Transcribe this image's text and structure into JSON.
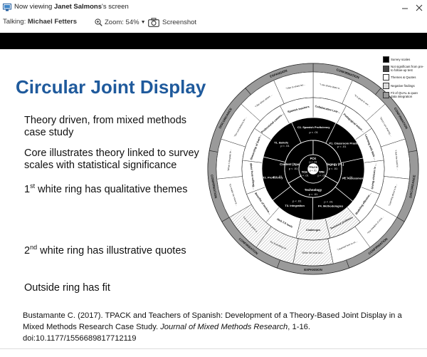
{
  "window": {
    "title_prefix": "Now viewing ",
    "presenter": "Janet Salmons",
    "title_suffix": "'s screen"
  },
  "toolbar": {
    "talking_label": "Talking: ",
    "talking_name": "Michael Fetters",
    "zoom_label": "Zoom: 54%",
    "screenshot_label": "Screenshot"
  },
  "slide": {
    "title": "Circular Joint Display",
    "bullets": [
      {
        "lines": [
          "Theory driven, from mixed methods",
          "case study"
        ]
      },
      {
        "lines": [
          "Core illustrates theory linked to survey",
          "scales with statistical significance"
        ]
      },
      {
        "pre": "1",
        "sup": "st",
        "post": " white ring has qualitative themes"
      },
      {
        "pre": "2",
        "sup": "nd",
        "post": " white ring has illustrative quotes"
      },
      {
        "lines": [
          "Outside ring has fit"
        ]
      }
    ],
    "citation": {
      "main": "Bustamante C. (2017). TPACK and Teachers of Spanish: Development of a Theory-Based Joint Display in a Mixed Methods Research Case Study. ",
      "journal": "Journal of Mixed Methods Research",
      "tail": ", 1-16. doi:10.1177/1556689817712119"
    }
  },
  "diagram": {
    "center": {
      "label": "TPACK",
      "value": "p < .01"
    },
    "core_sectors": [
      {
        "label": "PCK",
        "value": "p < .01"
      },
      {
        "label": "TPK",
        "value": "p < .01"
      },
      {
        "label": "TCK",
        "value": "p < .01"
      }
    ],
    "domains": [
      {
        "label": "Content (Spanish)",
        "value": "p < .01"
      },
      {
        "label": "Pedagogy (FL)",
        "value": "p < .01"
      },
      {
        "label": "Technology",
        "value": "p < .01"
      }
    ],
    "survey_scales": [
      {
        "label": "C1. Spanish Proficiency",
        "value": "p < .01"
      },
      {
        "label": "P1. Classroom Practices",
        "value": "p < .01"
      },
      {
        "label": "P2. Assessment",
        "value": "p < .01"
      },
      {
        "label": "P4. Methodologies",
        "value": "p < .01"
      },
      {
        "label": "T3. Integration",
        "value": "p < .01"
      },
      {
        "label": "T2. Proficiency",
        "value": "p < .01"
      },
      {
        "label": "T1. Beliefs",
        "value": "p < .01"
      }
    ],
    "themes": [
      "Collaborative Learning",
      "Pedagogical Intentionality",
      "Learning with Web 2.0",
      "Giving choices to students",
      "Modeling effective approaches",
      "Technical problems",
      "Challenges",
      "Web 2.0 tools",
      "Benefits of technology",
      "Ideas from colleagues",
      "Ownership of learning",
      "Professional community with Spanish teachers",
      "Spanish teachers"
    ],
    "quotes": [
      "\"I can share ideas with colleagues that are also learning\"",
      "\"It is great to see how others are using it\"",
      "\"Since I am sharing, I am more careful in my planning\"",
      "\"I feel the need to step up with what I'm doing\"",
      "\"Learning about a new tool is always fun...\"",
      "\"The freedom of choice has really motivated students\"",
      "\"I learned how to use a Smartboard\"",
      "\"When the tools do not work...\"",
      "\"It's frustrating when it doesn't work\"",
      "\"I'm not very good with technology\"",
      "\"It's made me more patient when I am trying something new\"",
      "\"When I integrate technology I see...\"",
      "\"Our connections formed with the other members of this class\"",
      "\"I like when others share their ideas\"",
      "\"I like to share lessons\""
    ],
    "fit_ring": [
      "CONFIRMATION",
      "CONFIRMATION",
      "DISCORDANCE",
      "CONFIRMATION",
      "EXPANSION",
      "CONFIRMATION",
      "CONFIRMATION",
      "DISCORDANCE",
      "EXPANSION"
    ],
    "legend": [
      {
        "label": "Survey scales",
        "swatch": "#000000"
      },
      {
        "label": "Not significant from pre-to follow-up test",
        "swatch": "#444444"
      },
      {
        "label": "Themes & Quotes",
        "swatch": "#ffffff"
      },
      {
        "label": "Negative findings",
        "swatch": "#dddddd"
      },
      {
        "label": "Fit of QUAL & quan data integration",
        "swatch": "#9a9a9a"
      }
    ]
  }
}
